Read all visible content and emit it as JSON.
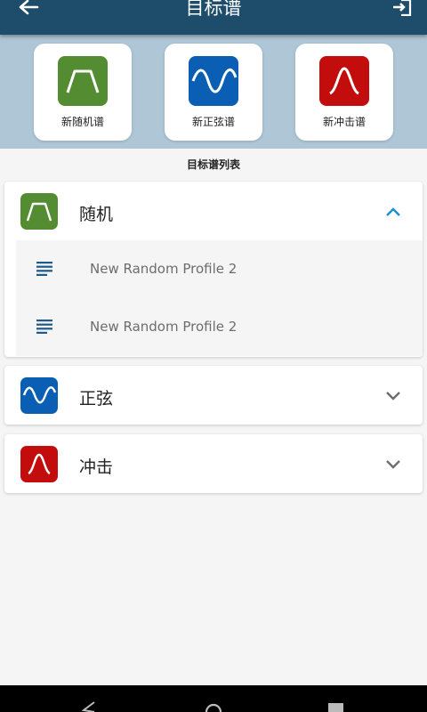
{
  "appbar": {
    "title": "目标谱",
    "back_icon": "arrow-left-icon",
    "exit_icon": "exit-icon"
  },
  "toolbar": {
    "buttons": [
      {
        "label": "新随机谱",
        "icon": "random-profile-icon",
        "color": "#548c31"
      },
      {
        "label": "新正弦谱",
        "icon": "sine-profile-icon",
        "color": "#0a5fb4"
      },
      {
        "label": "新冲击谱",
        "icon": "shock-profile-icon",
        "color": "#c30d0d"
      }
    ]
  },
  "list": {
    "title": "目标谱列表",
    "groups": [
      {
        "name": "随机",
        "icon": "random-profile-icon",
        "color": "#548c31",
        "expanded": true,
        "items": [
          {
            "label": "New Random Profile 2",
            "icon": "document-lines-icon"
          },
          {
            "label": "New Random Profile 2",
            "icon": "document-lines-icon"
          }
        ]
      },
      {
        "name": "正弦",
        "icon": "sine-profile-icon",
        "color": "#0a5fb4",
        "expanded": false
      },
      {
        "name": "冲击",
        "icon": "shock-profile-icon",
        "color": "#c30d0d",
        "expanded": false
      }
    ]
  },
  "colors": {
    "appbar": "#1e4d6b",
    "toolband": "#aec6d6",
    "accent": "#1a8fd1"
  },
  "navbar": {
    "icons": [
      "nav-back-icon",
      "nav-home-icon",
      "nav-recents-icon"
    ]
  }
}
